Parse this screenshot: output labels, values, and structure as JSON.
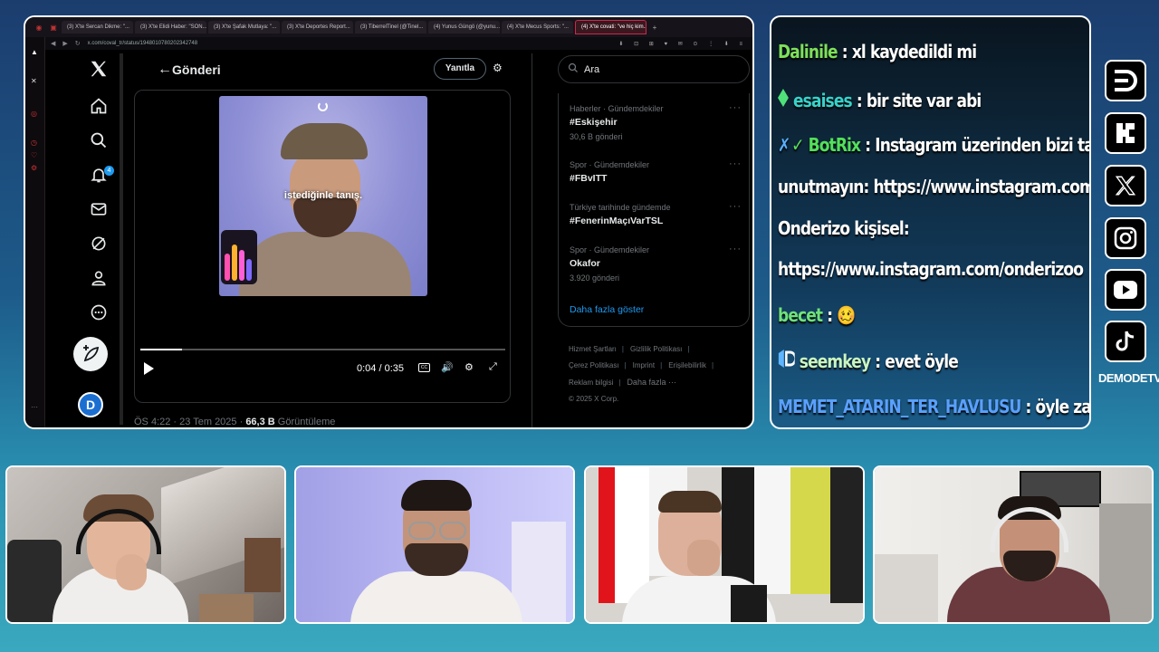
{
  "browser": {
    "tabs": [
      {
        "label": "(3) X'te Sercan Dikme: \"...",
        "active": false
      },
      {
        "label": "(3) X'te Elidi Haber: \"SON...",
        "active": false
      },
      {
        "label": "(3) X'te Şafak Mutlaya: \"...",
        "active": false
      },
      {
        "label": "(3) X'te Deportes Report...",
        "active": false
      },
      {
        "label": "(3) TiberrelTinel (@Tinel...",
        "active": false
      },
      {
        "label": "(4) Yunus Güngö (@yunu...",
        "active": false
      },
      {
        "label": "(4) X'te Mecus Sports: \"...",
        "active": false
      },
      {
        "label": "(4) X'te covati: \"ve hiç kim...",
        "active": true
      }
    ],
    "url": "x.com/coval_tr/status/1948010780202342748"
  },
  "x": {
    "notifications_badge": "4",
    "header": {
      "title": "Gönderi",
      "reply_label": "Yanıtla"
    },
    "video": {
      "subtitle": "istediğinle tanış.",
      "time": "0:04 / 0:35",
      "progress": 0.114
    },
    "post_meta": {
      "time": "ÖS 4:22 · 23 Tem 2025 · ",
      "views": "66,3 B",
      "views_label": " Görüntüleme"
    },
    "search_placeholder": "Ara",
    "trends": [
      {
        "category": "Haberler · Gündemdekiler",
        "tag": "#Eskişehir",
        "count": "30,6 B gönderi"
      },
      {
        "category": "Spor · Gündemdekiler",
        "tag": "#FBvITT",
        "count": ""
      },
      {
        "category": "Türkiye tarihinde gündemde",
        "tag": "#FenerinMaçıVarTSL",
        "count": ""
      },
      {
        "category": "Spor · Gündemdekiler",
        "tag": "Okafor",
        "count": "3.920 gönderi"
      }
    ],
    "show_more": "Daha fazla göster",
    "footer": {
      "terms": "Hizmet Şartları",
      "privacy": "Gizlilik Politikası",
      "cookies": "Çerez Politikası",
      "imprint": "Imprint",
      "accessibility": "Erişilebilirlik",
      "ads": "Reklam bilgisi",
      "more": "Daha fazla ···",
      "copyright": "© 2025 X Corp."
    }
  },
  "chat": {
    "messages": [
      {
        "user": "Dalinile",
        "text": " : xl kaydedildi mi",
        "color": "#7ee05a",
        "icon": ""
      },
      {
        "user": "esaises",
        "text": " : bir site var abi",
        "color": "#39d1c8",
        "icon": "diamond"
      },
      {
        "user": "BotRix",
        "text": " : Instagram üzerinden bizi takip etmeyi",
        "color": "#53e05a",
        "icon": "bot"
      },
      {
        "user": "",
        "text": "unutmayın: https://www.instagram.com/demodetv",
        "color": "#ffffff",
        "icon": ""
      },
      {
        "user": "",
        "text": "Onderizo kişisel:",
        "color": "#ffffff",
        "icon": ""
      },
      {
        "user": "",
        "text": "https://www.instagram.com/onderizoo",
        "color": "#ffffff",
        "icon": ""
      },
      {
        "user": "becet",
        "text": " : ",
        "color": "#6fe27a",
        "icon": "",
        "emote": "🥴"
      },
      {
        "user": "seemkey",
        "text": " : evet öyle",
        "color": "#c9f5c2",
        "icon": "kick"
      },
      {
        "user": "MEMET_ATARIN_TER_HAVLUSU",
        "text": " : öyle zaten",
        "color": "#5aa0ff",
        "icon": ""
      }
    ]
  },
  "social": {
    "icons": [
      "kick-d-icon",
      "kick-k-icon",
      "x-icon",
      "instagram-icon",
      "youtube-icon",
      "tiktok-icon"
    ],
    "brand": "DEMODETV"
  }
}
